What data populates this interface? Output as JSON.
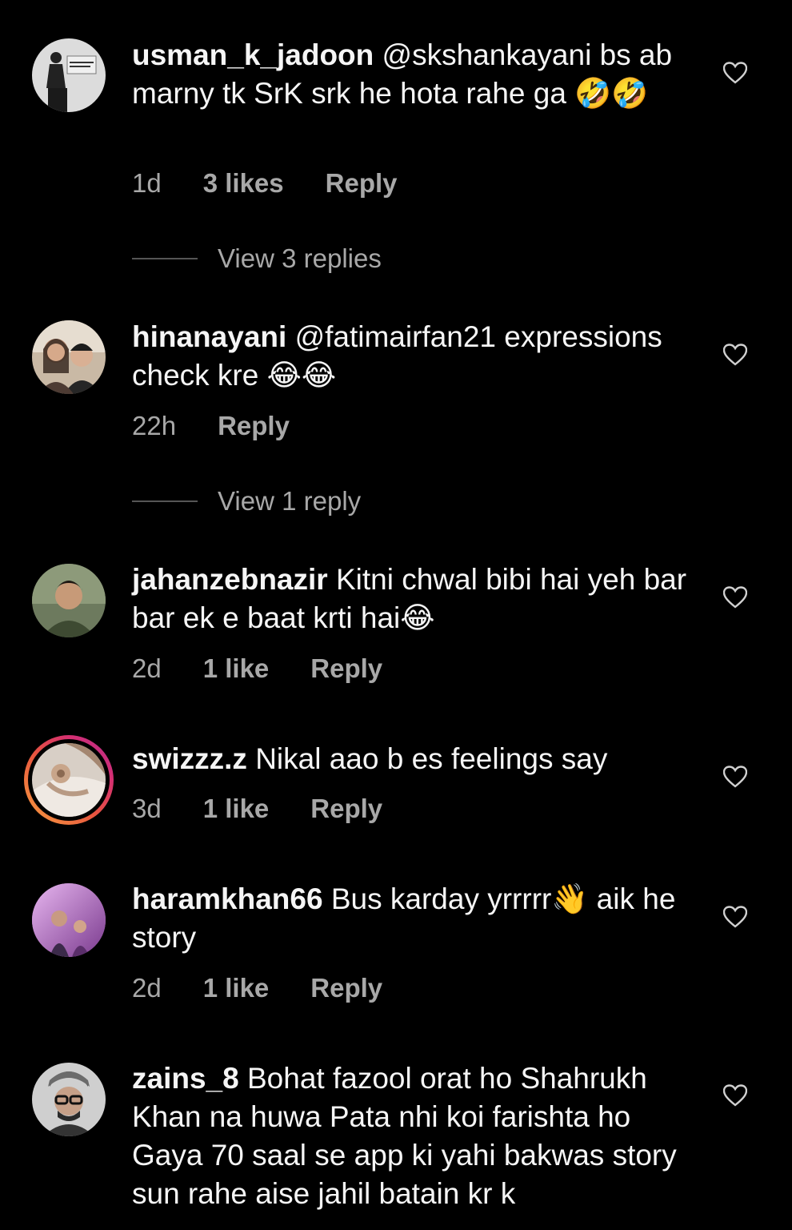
{
  "comments": [
    {
      "username": "usman_k_jadoon",
      "text": "@skshankayani bs ab marny tk SrK srk he hota rahe ga 🤣🤣",
      "time": "1d",
      "likes": "3 likes",
      "reply_label": "Reply",
      "view_replies": "View 3 replies"
    },
    {
      "username": "hinanayani",
      "text": "@fatimairfan21 expressions check kre 😂😂",
      "time": "22h",
      "likes": "",
      "reply_label": "Reply",
      "view_replies": "View 1 reply"
    },
    {
      "username": "jahanzebnazir",
      "text": "Kitni chwal bibi hai yeh bar bar ek e baat krti hai😂",
      "time": "2d",
      "likes": "1 like",
      "reply_label": "Reply"
    },
    {
      "username": "swizzz.z",
      "text": "Nikal aao b es feelings say",
      "time": "3d",
      "likes": "1 like",
      "reply_label": "Reply"
    },
    {
      "username": "haramkhan66",
      "text": "Bus karday yrrrrr👋 aik he story",
      "time": "2d",
      "likes": "1 like",
      "reply_label": "Reply"
    },
    {
      "username": "zains_8",
      "text": "Bohat fazool orat ho Shahrukh Khan na huwa Pata nhi koi farishta ho Gaya 70 saal se app ki yahi bakwas story sun rahe aise jahil batain kr k",
      "time": "",
      "likes": "",
      "reply_label": ""
    }
  ]
}
